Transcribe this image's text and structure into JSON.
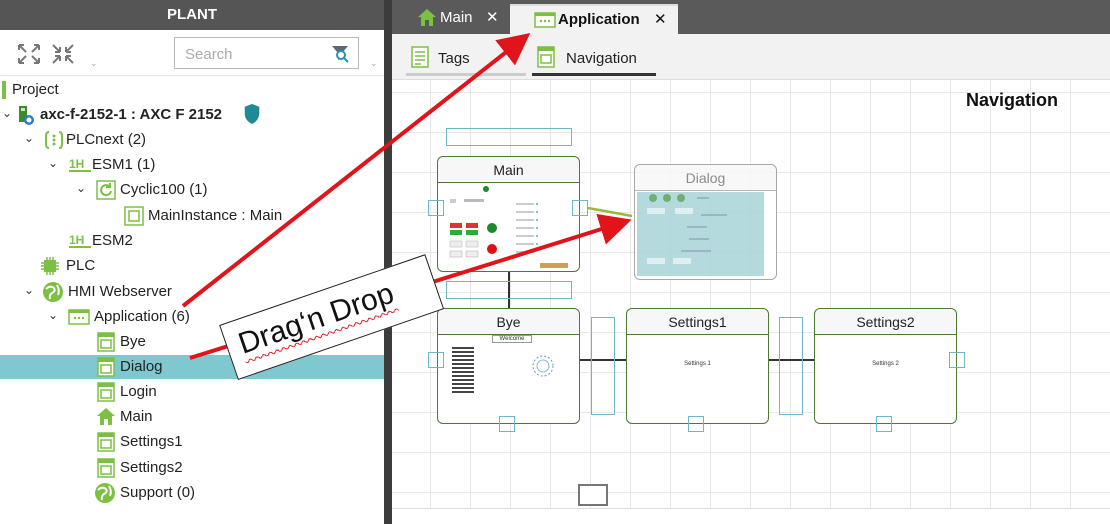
{
  "plant": {
    "header": "PLANT",
    "search_placeholder": "Search"
  },
  "tree": {
    "project": "Project",
    "controller": "axc-f-2152-1 : AXC F 2152",
    "plcnext": "PLCnext (2)",
    "esm1": "ESM1 (1)",
    "cyclic": "Cyclic100 (1)",
    "main_instance": "MainInstance : Main",
    "esm2": "ESM2",
    "plc": "PLC",
    "hmi": "HMI Webserver",
    "application": "Application (6)",
    "pages": [
      "Bye",
      "Dialog",
      "Login",
      "Main",
      "Settings1",
      "Settings2"
    ],
    "support": "Support (0)"
  },
  "tabs": {
    "main": "Main",
    "application": "Application",
    "close": "✕"
  },
  "subtabs": {
    "tags": "Tags",
    "navigation": "Navigation"
  },
  "canvas": {
    "title": "Navigation",
    "cards": {
      "main": "Main",
      "dialog": "Dialog",
      "bye": "Bye",
      "settings1": "Settings1",
      "settings2": "Settings2"
    },
    "bye_inner": "Welcome",
    "settings1_inner": "Settings 1",
    "settings2_inner": "Settings 2"
  },
  "annotation": {
    "text": "Drag‘n Drop"
  },
  "colors": {
    "accent_green": "#4a7a34",
    "selection": "#7fc8cf",
    "arrow_red": "#e0141a",
    "handle_teal": "#6cb8c4"
  }
}
